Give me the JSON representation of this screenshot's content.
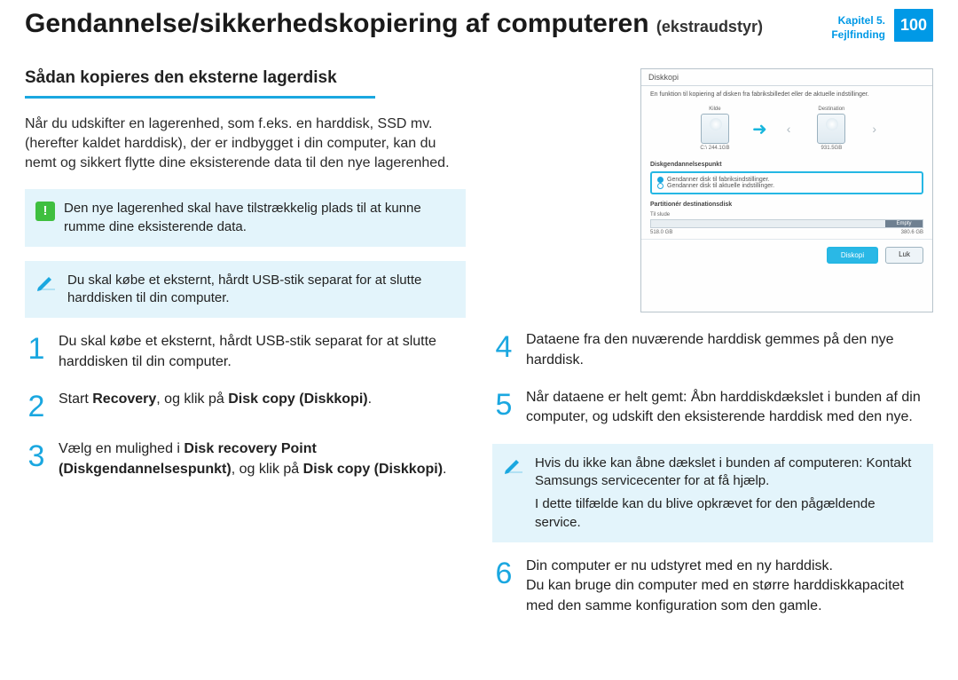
{
  "header": {
    "title_main": "Gendannelse/sikkerhedskopiering af computeren",
    "title_sub": "(ekstraudstyr)",
    "chapter_line1": "Kapitel 5.",
    "chapter_line2": "Fejlfinding",
    "page_number": "100"
  },
  "left": {
    "section_title": "Sådan kopieres den eksterne lagerdisk",
    "intro": "Når du udskifter en lagerenhed, som f.eks. en harddisk, SSD mv. (herefter kaldet harddisk), der er indbygget i din computer, kan du nemt og sikkert flytte dine eksisterende data til den nye lagerenhed.",
    "callout_green": "Den nye lagerenhed skal have tilstrækkelig plads til at kunne rumme dine eksisterende data.",
    "callout_note": "Du skal købe et eksternt, hårdt USB-stik separat for at slutte harddisken til din computer.",
    "step1": "Du skal købe et eksternt, hårdt USB-stik separat for at slutte harddisken til din computer.",
    "step2_a": "Start ",
    "step2_b": "Recovery",
    "step2_c": ", og klik på ",
    "step2_d": "Disk copy (Diskkopi)",
    "step2_e": ".",
    "step3_a": "Vælg en mulighed i ",
    "step3_b": "Disk recovery Point (Diskgendannelsespunkt)",
    "step3_c": ", og klik på ",
    "step3_d": "Disk copy (Diskkopi)",
    "step3_e": "."
  },
  "right": {
    "mock": {
      "title": "Diskkopi",
      "desc": "En funktion til kopiering af disken fra fabriksbilledet eller de aktuelle indstillinger.",
      "source_label": "Kilde",
      "dest_label": "Destination",
      "source_cap": "C:\\ 244.1GB",
      "dest_cap": "931.5GB",
      "section_point": "Diskgendannelsespunkt",
      "radio1": "Gendanner disk til fabriksindstillinger.",
      "radio2": "Gendanner disk til aktuelle indstillinger.",
      "section_part": "Partitionér destinationsdisk",
      "part_header": "Til slude",
      "part_cap_label": "Empty",
      "part_left": "518.0 GB",
      "part_right": "380.6 GB",
      "btn_copy": "Diskopi",
      "btn_close": "Luk"
    },
    "step4": "Dataene fra den nuværende harddisk gemmes på den nye harddisk.",
    "step5": "Når dataene er helt gemt: Åbn harddiskdækslet i bunden af din computer, og udskift den eksisterende harddisk med den nye.",
    "callout_note_a": "Hvis du ikke kan åbne dækslet i bunden af computeren: Kontakt Samsungs servicecenter for at få hjælp.",
    "callout_note_b": "I dette tilfælde kan du blive opkrævet for den pågældende service.",
    "step6_a": "Din computer er nu udstyret med en ny harddisk.",
    "step6_b": "Du kan bruge din computer med en større harddiskkapacitet med den samme konfiguration som den gamle."
  },
  "numbers": {
    "n1": "1",
    "n2": "2",
    "n3": "3",
    "n4": "4",
    "n5": "5",
    "n6": "6"
  },
  "icons": {
    "warn": "!",
    "arrow": "➜",
    "lchev": "‹",
    "rchev": "›"
  }
}
